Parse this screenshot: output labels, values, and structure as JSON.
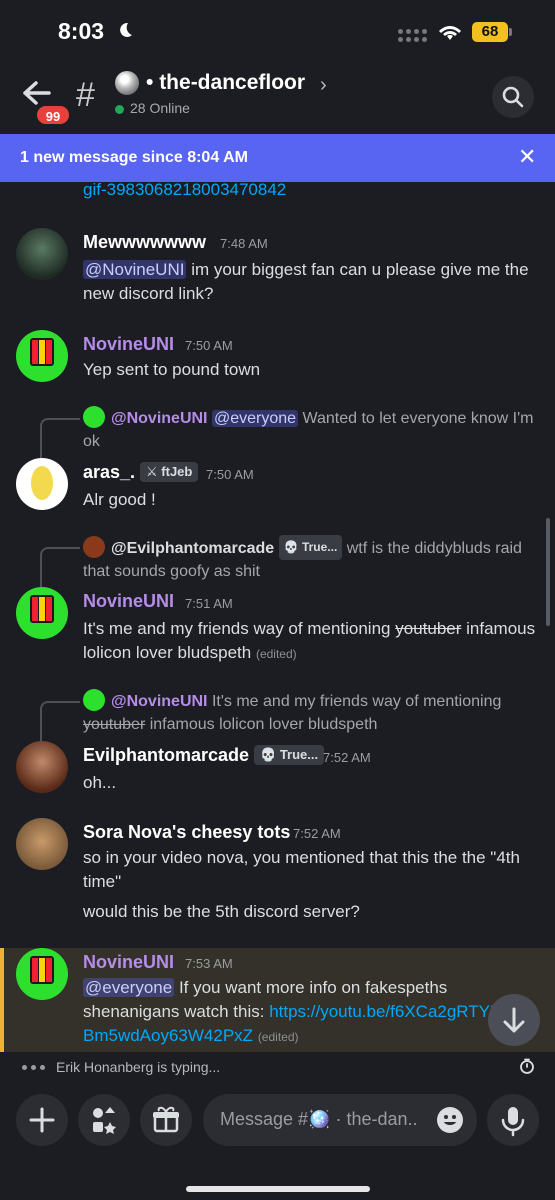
{
  "status_bar": {
    "time": "8:03",
    "battery": "68"
  },
  "header": {
    "back_badge": "99",
    "channel_emoji": "mirror-ball",
    "channel_name": "the-dancefloor",
    "online": "28 Online"
  },
  "banner": {
    "text": "1 new message since 8:04 AM"
  },
  "messages": {
    "gif_link": "gif-3983068218003470842",
    "m1": {
      "author": "Mewwwwwww",
      "time": "7:48 AM",
      "mention": "@NovineUNI",
      "text": "im your biggest fan can u please give me the new discord link?"
    },
    "m2": {
      "author": "NovineUNI",
      "time": "7:50 AM",
      "text": "Yep sent to pound town"
    },
    "m3": {
      "reply_author": "@NovineUNI",
      "reply_mention": "@everyone",
      "reply_text": "Wanted to let everyone know I'm ok",
      "author": "aras_.",
      "tag": "ftJeb",
      "time": "7:50 AM",
      "text": "Alr good !"
    },
    "m4": {
      "reply_author": "@Evilphantomarcade",
      "reply_tag": "True...",
      "reply_text": "wtf is the diddybluds raid that sounds goofy as shit",
      "author": "NovineUNI",
      "time": "7:51 AM",
      "text_before": "It's me and my friends way of mentioning",
      "text_strike": "youtuber",
      "text_after": "infamous lolicon lover bludspeth",
      "edited": "(edited)"
    },
    "m5": {
      "reply_author": "@NovineUNI",
      "reply_text_before": "It's me and my friends way of mentioning",
      "reply_strike": "youtuber",
      "reply_text_after": "infamous lolicon lover bludspeth",
      "author": "Evilphantomarcade",
      "tag": "True...",
      "time": "7:52 AM",
      "text": "oh..."
    },
    "m6": {
      "author": "Sora Nova's cheesy tots",
      "time": "7:52 AM",
      "line1": "so in your video nova, you mentioned that this the the \"4th time\"",
      "line2": "would this be the 5th discord server?"
    },
    "m7": {
      "author": "NovineUNI",
      "time": "7:53 AM",
      "mention": "@everyone",
      "text": "If you want more info on fakespeths shenanigans watch this:",
      "link": "https://youtu.be/f6XCa2gRTYM?si=Bm5wdAoy63W42PxZ",
      "edited": "(edited)"
    }
  },
  "typing": {
    "text": "Erik Honanberg is typing..."
  },
  "composer": {
    "placeholder": "Message #🪩 · the-dan.."
  },
  "colors": {
    "accent": "#5865f2",
    "mention_purple": "#b58ce8",
    "link": "#00a8fc",
    "highlight": "#f0b232"
  }
}
